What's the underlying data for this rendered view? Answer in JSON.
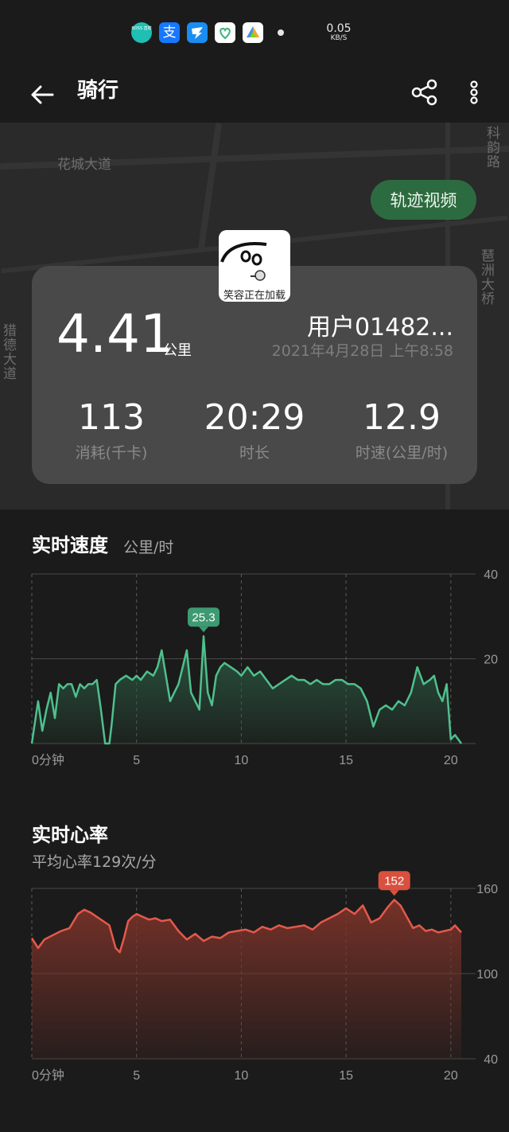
{
  "status_bar": {
    "apps": [
      {
        "icon": "boss-app-icon",
        "label": "BOSS 直聘",
        "color": "#1fbfb3"
      },
      {
        "icon": "alipay-icon",
        "label": "支",
        "color": "#1677ff"
      },
      {
        "icon": "dingtalk-icon",
        "label": "",
        "color": "#1b8cf0"
      },
      {
        "icon": "health-app-icon",
        "label": "",
        "color": "#ffffff"
      },
      {
        "icon": "photos-app-icon",
        "label": "",
        "color": "#ffffff"
      }
    ],
    "net_speed": "0.05",
    "net_unit": "KB/S"
  },
  "app_bar": {
    "title": "骑行",
    "back_icon": "arrow-left-icon",
    "share_icon": "share-icon",
    "more_icon": "more-vertical-icon"
  },
  "map": {
    "labels": [
      "花城大道",
      "科韵路",
      "琶洲大桥",
      "猎德大道"
    ],
    "track_video_button": "轨迹视频"
  },
  "summary": {
    "avatar_caption": "笑容正在加载",
    "distance_value": "4.41",
    "distance_unit": "公里",
    "user_name": "用户01482...",
    "date": "2021年4月28日 上午8:58",
    "stats": [
      {
        "value": "113",
        "label": "消耗(千卡)"
      },
      {
        "value": "20:29",
        "label": "时长"
      },
      {
        "value": "12.9",
        "label": "时速(公里/时)"
      }
    ]
  },
  "speed_section": {
    "title": "实时速度",
    "unit": "公里/时"
  },
  "heart_section": {
    "title": "实时心率",
    "subtitle": "平均心率129次/分"
  },
  "colors": {
    "speed_line": "#4fc08d",
    "speed_fill": "#2b5a42",
    "speed_badge": "#3e9a72",
    "heart_line": "#e5594b",
    "heart_fill": "#7a3329",
    "heart_badge": "#d9503f",
    "accent_green": "#2c6b3f"
  },
  "chart_data": [
    {
      "type": "area",
      "title": "实时速度",
      "ylabel": "公里/时",
      "xlabel": "",
      "xlim": [
        0,
        20.5
      ],
      "ylim": [
        0,
        40
      ],
      "x_ticks": [
        "0分钟",
        "5",
        "10",
        "15",
        "20"
      ],
      "y_ticks": [
        "40",
        "20"
      ],
      "grid": true,
      "annotation": {
        "label": "25.3",
        "x": 8.2,
        "y": 25.3
      },
      "x": [
        0,
        0.3,
        0.5,
        0.7,
        0.9,
        1.1,
        1.3,
        1.5,
        1.7,
        1.9,
        2.1,
        2.3,
        2.5,
        2.7,
        2.9,
        3.1,
        3.3,
        3.5,
        3.6,
        3.7,
        3.8,
        4.0,
        4.2,
        4.5,
        4.8,
        5.0,
        5.2,
        5.5,
        5.8,
        6.0,
        6.2,
        6.4,
        6.6,
        6.8,
        7.0,
        7.2,
        7.4,
        7.6,
        7.8,
        8.0,
        8.2,
        8.4,
        8.6,
        8.8,
        9.0,
        9.2,
        9.5,
        9.8,
        10.0,
        10.3,
        10.6,
        10.9,
        11.2,
        11.5,
        11.8,
        12.1,
        12.4,
        12.7,
        13.0,
        13.3,
        13.6,
        13.9,
        14.2,
        14.5,
        14.8,
        15.1,
        15.4,
        15.7,
        16.0,
        16.3,
        16.6,
        16.9,
        17.2,
        17.5,
        17.8,
        18.1,
        18.4,
        18.7,
        19.0,
        19.2,
        19.4,
        19.6,
        19.8,
        20.0,
        20.2,
        20.5
      ],
      "values": [
        0,
        10,
        3,
        8,
        12,
        6,
        14,
        13,
        14,
        14,
        11,
        14,
        13,
        14,
        14,
        15,
        8,
        0,
        0,
        0,
        4,
        14,
        15,
        16,
        15,
        16,
        15,
        17,
        16,
        18,
        22,
        16,
        10,
        12,
        14,
        18,
        22,
        12,
        10,
        8,
        25.3,
        12,
        9,
        16,
        18,
        19,
        18,
        17,
        16,
        18,
        16,
        17,
        15,
        13,
        14,
        15,
        16,
        15,
        15,
        14,
        15,
        14,
        14,
        15,
        15,
        14,
        14,
        13,
        10,
        4,
        8,
        9,
        8,
        10,
        9,
        12,
        18,
        14,
        15,
        16,
        12,
        10,
        14,
        1,
        2,
        0
      ]
    },
    {
      "type": "area",
      "title": "实时心率",
      "subtitle": "平均心率129次/分",
      "xlabel": "",
      "ylabel": "",
      "xlim": [
        0,
        20.5
      ],
      "ylim": [
        40,
        160
      ],
      "x_ticks": [
        "0分钟",
        "5",
        "10",
        "15",
        "20"
      ],
      "y_ticks": [
        "160",
        "100",
        "40"
      ],
      "grid": true,
      "annotation": {
        "label": "152",
        "x": 17.3,
        "y": 152
      },
      "x": [
        0,
        0.3,
        0.6,
        1.0,
        1.4,
        1.8,
        2.2,
        2.5,
        2.8,
        3.1,
        3.4,
        3.7,
        4.0,
        4.2,
        4.4,
        4.6,
        4.8,
        5.0,
        5.3,
        5.6,
        5.9,
        6.2,
        6.6,
        7.0,
        7.4,
        7.8,
        8.2,
        8.6,
        9.0,
        9.4,
        9.8,
        10.2,
        10.6,
        11.0,
        11.4,
        11.8,
        12.2,
        12.6,
        13.0,
        13.4,
        13.8,
        14.2,
        14.6,
        15.0,
        15.4,
        15.8,
        16.2,
        16.6,
        17.0,
        17.3,
        17.6,
        17.9,
        18.2,
        18.5,
        18.8,
        19.1,
        19.4,
        19.7,
        20.0,
        20.2,
        20.5
      ],
      "values": [
        125,
        118,
        124,
        127,
        130,
        132,
        142,
        145,
        143,
        140,
        137,
        134,
        118,
        115,
        125,
        137,
        140,
        142,
        140,
        138,
        139,
        137,
        138,
        130,
        124,
        128,
        123,
        126,
        125,
        129,
        130,
        131,
        129,
        133,
        131,
        134,
        132,
        133,
        134,
        131,
        136,
        139,
        142,
        146,
        142,
        148,
        136,
        139,
        147,
        152,
        148,
        140,
        132,
        134,
        130,
        131,
        129,
        130,
        131,
        134,
        129
      ]
    }
  ]
}
